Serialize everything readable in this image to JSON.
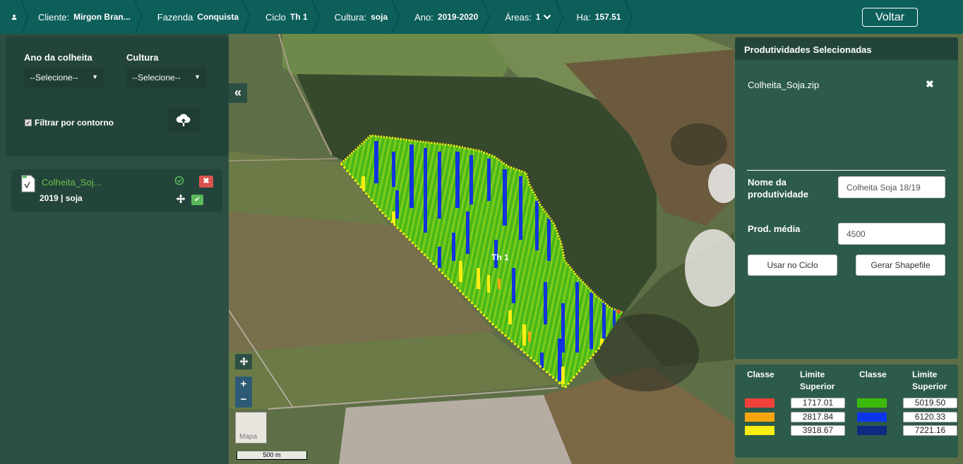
{
  "topbar": {
    "cliente_label": "Cliente:",
    "cliente_value": "Mirgon Bran...",
    "fazenda_label": "Fazenda",
    "fazenda_value": "Conquista",
    "ciclo_label": "Ciclo",
    "ciclo_value": "Th 1",
    "cultura_label": "Cultura:",
    "cultura_value": "soja",
    "ano_label": "Ano:",
    "ano_value": "2019-2020",
    "areas_label": "Áreas:",
    "areas_value": "1",
    "ha_label": "Ha:",
    "ha_value": "157.51",
    "voltar": "Voltar"
  },
  "filters": {
    "ano_label": "Ano da colheita",
    "ano_select": "--Selecione--",
    "cultura_label": "Cultura",
    "cultura_select": "--Selecione--",
    "contour_label": "Filtrar por contorno"
  },
  "file_item": {
    "name": "Colheita_Soj...",
    "meta": "2019 | soja"
  },
  "map": {
    "field_label": "Th 1",
    "thumb_label": "Mapa",
    "scale": "500 m",
    "zoom_in": "+",
    "zoom_out": "−"
  },
  "right_panel": {
    "header": "Produtividades Selecionadas",
    "file": "Colheita_Soja.zip",
    "nome_label_1": "Nome da",
    "nome_label_2": "produtividade",
    "nome_value": "Colheita Soja 18/19",
    "prod_label": "Prod. média",
    "prod_value": "4500",
    "usar_btn": "Usar no Ciclo",
    "gerar_btn": "Gerar Shapefile"
  },
  "legend": {
    "classe": "Classe",
    "limite_1": "Limite",
    "limite_2": "Superior",
    "rows_left": [
      {
        "color": "#f0413c",
        "value": "1717.01"
      },
      {
        "color": "#f7a50f",
        "value": "2817.84"
      },
      {
        "color": "#f8ee12",
        "value": "3918.67"
      }
    ],
    "rows_right": [
      {
        "color": "#3dbb0c",
        "value": "5019.50"
      },
      {
        "color": "#0b35ee",
        "value": "6120.33"
      },
      {
        "color": "#0c2a82",
        "value": "7221.16"
      }
    ]
  }
}
